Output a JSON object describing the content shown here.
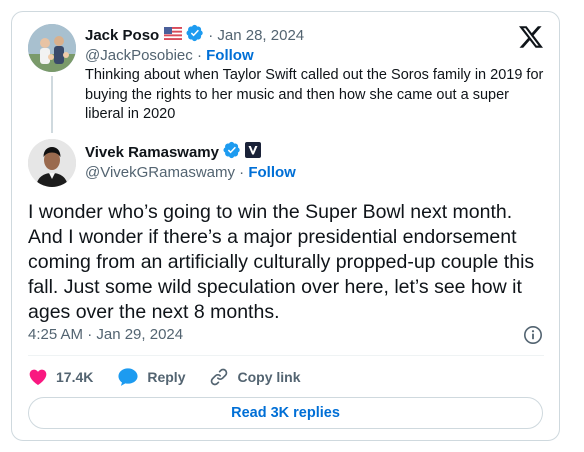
{
  "quoted_tweet": {
    "display_name": "Jack Poso",
    "flag_icon": "us-flag-icon",
    "verified_icon": "verified-badge-icon",
    "date": "· Jan 28, 2024",
    "handle": "@JackPosobiec",
    "separator": " · ",
    "follow_label": "Follow",
    "text": "Thinking about when Taylor Swift called out the Soros family in 2019 for buying the rights to her music and then how she came out a super liberal in 2020"
  },
  "main_tweet": {
    "display_name": "Vivek Ramaswamy",
    "verified_icon": "verified-badge-icon",
    "affiliate_icon": "affiliate-badge-icon",
    "handle": "@VivekGRamaswamy",
    "separator": " · ",
    "follow_label": "Follow",
    "text": "I wonder who’s going to win the Super Bowl next month. And I wonder if there’s a major presidential endorsement coming from an artificially culturally propped-up couple this fall. Just some wild speculation over here, let’s see how it ages over the next 8 months.",
    "timestamp": "4:25 AM · Jan 29, 2024"
  },
  "actions": {
    "like_count": "17.4K",
    "reply_label": "Reply",
    "copy_link_label": "Copy link"
  },
  "read_replies_label": "Read 3K replies",
  "colors": {
    "link_blue": "#006fd6",
    "like_pink": "#f91880",
    "verified_blue": "#1d9bf0",
    "muted_text": "#536471",
    "border": "#cfd9de"
  }
}
